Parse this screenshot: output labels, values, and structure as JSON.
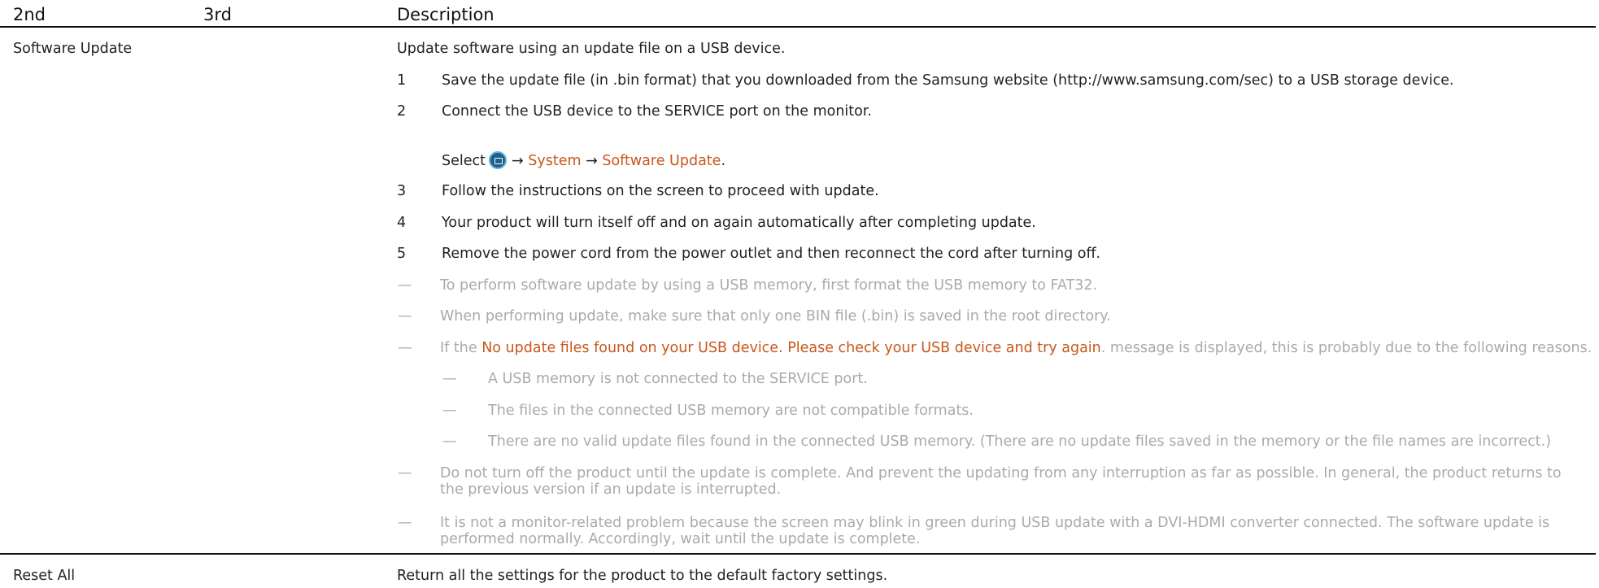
{
  "header": {
    "col2": "2nd",
    "col3": "3rd",
    "col_desc": "Description"
  },
  "software_update": {
    "label": "Software Update",
    "intro": "Update software using an update file on a USB device.",
    "steps": [
      {
        "num": "1",
        "text": "Save the update file (in .bin format) that you downloaded from the Samsung website (http://www.samsung.com/sec) to a USB storage device."
      },
      {
        "num": "2",
        "text": "Connect the USB device to the SERVICE port on the monitor."
      },
      {
        "num": "3",
        "text": "Follow the instructions on the screen to proceed with update."
      },
      {
        "num": "4",
        "text": "Your product will turn itself off and on again automatically after completing update."
      },
      {
        "num": "5",
        "text": "Remove the power cord from the power outlet and then reconnect the cord after turning off."
      }
    ],
    "select_line": {
      "select": "Select",
      "icon": "menu-icon",
      "arrow": "→",
      "system": "System",
      "software_update": "Software Update",
      "period": "."
    },
    "notes": {
      "dash": "—",
      "n1": "To perform software update by using a USB memory, first format the USB memory to FAT32.",
      "n2": "When performing update, make sure that only one BIN file (.bin) is saved in the root directory.",
      "n3_prefix": "If the",
      "n3_highlight": "No update files found on your USB device. Please check your USB device and try again",
      "n3_suffix": ". message is displayed, this is probably due to the following reasons.",
      "sub1": "A USB memory is not connected to the SERVICE port.",
      "sub2": "The files in the connected USB memory are not compatible formats.",
      "sub3": "There are no valid update files found in the connected USB memory. (There are no update files saved in the memory or the file names are incorrect.)",
      "n4": "Do not turn off the product until the update is complete. And prevent the updating from any interruption as far as possible. In general, the product returns to the previous version if an update is interrupted.",
      "n5": "It is not a monitor-related problem because the screen may blink in green during USB update with a DVI-HDMI converter connected. The software update is performed normally. Accordingly, wait until the update is complete."
    },
    "colors": {
      "accent": "#c8571b",
      "note": "#aaaaaa",
      "text": "#222222"
    }
  },
  "reset_all": {
    "label": "Reset All",
    "text": "Return all the settings for the product to the default factory settings."
  }
}
